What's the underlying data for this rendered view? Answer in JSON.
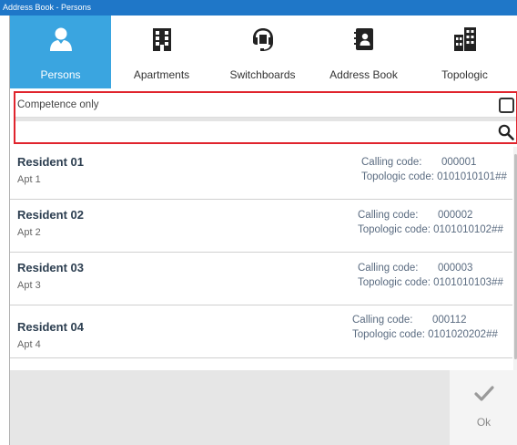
{
  "window": {
    "title": "Address Book - Persons"
  },
  "tabs": [
    {
      "label": "Persons",
      "icon": "person-icon",
      "active": true
    },
    {
      "label": "Apartments",
      "icon": "building-icon",
      "active": false
    },
    {
      "label": "Switchboards",
      "icon": "headset-icon",
      "active": false
    },
    {
      "label": "Address Book",
      "icon": "contacts-book-icon",
      "active": false
    },
    {
      "label": "Topologic",
      "icon": "buildings-icon",
      "active": false
    }
  ],
  "filter": {
    "competence_label": "Competence only",
    "competence_checked": false,
    "search_value": "",
    "search_placeholder": ""
  },
  "residents": [
    {
      "name": "Resident 01",
      "apt": "Apt 1",
      "calling_label": "Calling code:",
      "calling_code": "000001",
      "topologic_label": "Topologic code:",
      "topologic_code": "0101010101##"
    },
    {
      "name": "Resident 02",
      "apt": "Apt 2",
      "calling_label": "Calling code:",
      "calling_code": "000002",
      "topologic_label": "Topologic code:",
      "topologic_code": "0101010102##"
    },
    {
      "name": "Resident 03",
      "apt": "Apt 3",
      "calling_label": "Calling code:",
      "calling_code": "000003",
      "topologic_label": "Topologic code:",
      "topologic_code": "0101010103##"
    },
    {
      "name": "Resident 04",
      "apt": "Apt 4",
      "calling_label": "Calling code:",
      "calling_code": "000112",
      "topologic_label": "Topologic code:",
      "topologic_code": "0101020202##"
    }
  ],
  "footer": {
    "ok_label": "Ok",
    "ok_icon": "checkmark-icon"
  },
  "colors": {
    "titlebar": "#1f77c8",
    "active_tab": "#3aa5e0",
    "filter_border": "#e0242d"
  }
}
